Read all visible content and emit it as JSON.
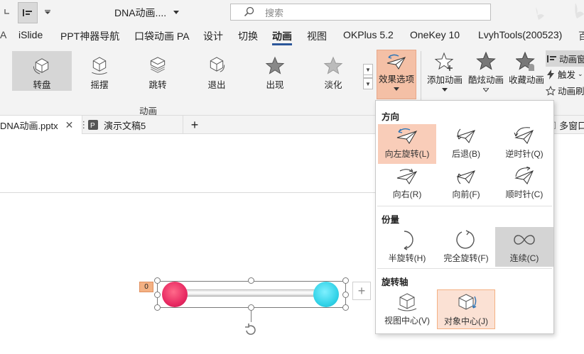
{
  "title_bar": {
    "doc_title": "DNA动画....",
    "search_placeholder": "搜索"
  },
  "ribbon_tabs": [
    {
      "label": "iSlide"
    },
    {
      "label": "PPT神器导航"
    },
    {
      "label": "口袋动画 PA"
    },
    {
      "label": "设计"
    },
    {
      "label": "切换"
    },
    {
      "label": "动画"
    },
    {
      "label": "视图"
    },
    {
      "label": "OKPlus 5.2"
    },
    {
      "label": "OneKey 10"
    },
    {
      "label": "LvyhTools(200523)"
    }
  ],
  "animation_gallery": [
    {
      "label": "转盘",
      "icon": "turntable-icon",
      "selected": true
    },
    {
      "label": "摇摆",
      "icon": "swing-icon"
    },
    {
      "label": "跳转",
      "icon": "bounce-icon"
    },
    {
      "label": "退出",
      "icon": "exit-icon"
    },
    {
      "label": "出现",
      "icon": "star-appear-icon"
    },
    {
      "label": "淡化",
      "icon": "star-fade-icon"
    }
  ],
  "animation_group_label": "动画",
  "effect_options_label": "效果选项",
  "advanced_buttons": [
    {
      "label": "添加动画",
      "icon": "add-animation-star-icon"
    },
    {
      "label": "酷炫动画",
      "icon": "cool-animation-star-icon"
    },
    {
      "label": "收藏动画",
      "icon": "favorite-animation-star-icon"
    }
  ],
  "side_buttons": [
    {
      "label": "动画窗"
    },
    {
      "label": "触发"
    },
    {
      "label": "动画刷"
    }
  ],
  "doc_tabs": [
    {
      "label": "DNA动画.pptx"
    },
    {
      "label": "演示文稿5"
    }
  ],
  "multi_window_label": "多窗口",
  "effect_dropdown": {
    "direction_header": "方向",
    "direction_items": [
      {
        "label": "向左旋转(L)",
        "selected": true
      },
      {
        "label": "后退(B)"
      },
      {
        "label": "逆时针(Q)"
      },
      {
        "label": "向右(R)"
      },
      {
        "label": "向前(F)"
      },
      {
        "label": "顺时针(C)"
      }
    ],
    "amount_header": "份量",
    "amount_items": [
      {
        "label": "半旋转(H)"
      },
      {
        "label": "完全旋转(F)"
      },
      {
        "label": "连续(C)",
        "selected": true
      }
    ],
    "axis_header": "旋转轴",
    "axis_items": [
      {
        "label": "视图中心(V)"
      },
      {
        "label": "对象中心(J)",
        "hover": true
      }
    ]
  },
  "slide": {
    "animation_tag": "0",
    "colors": {
      "left_ball": "#e82a62",
      "right_ball": "#33d3e8",
      "accent": "#c55a11",
      "tag": "#f4b183"
    }
  }
}
